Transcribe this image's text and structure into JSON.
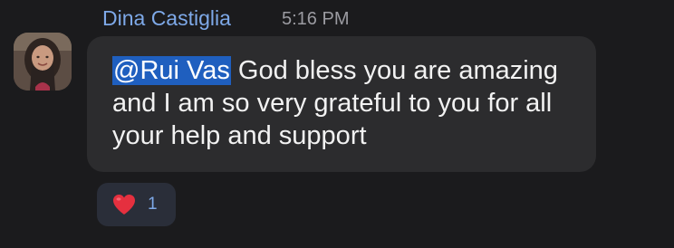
{
  "message": {
    "sender_name": "Dina Castiglia",
    "timestamp": "5:16 PM",
    "mention": "@Rui Vas",
    "body": " God bless you are amazing and I am so very grateful to you for all your help and support",
    "reaction": {
      "icon": "heart-icon",
      "count": "1"
    }
  },
  "colors": {
    "background": "#1b1b1d",
    "bubble": "#2c2c2e",
    "sender": "#7ea9e8",
    "mention_highlight": "#1f5fbf",
    "heart": "#e5303f"
  }
}
